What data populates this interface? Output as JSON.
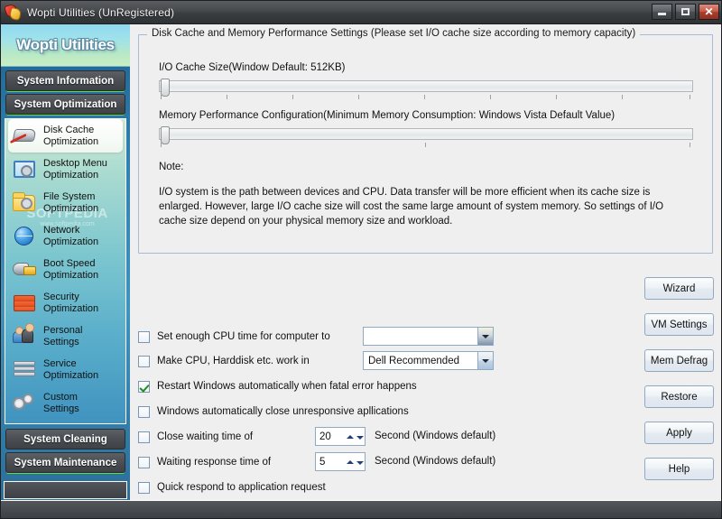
{
  "window": {
    "title": "Wopti Utilities (UnRegistered)",
    "icon": "app-shield-icon",
    "controls": {
      "minimize": "minimize-icon",
      "maximize": "maximize-icon",
      "close": "✕"
    }
  },
  "sidebar": {
    "brand": "Wopti Utilities",
    "top_buttons": [
      {
        "label": "System Information"
      },
      {
        "label": "System Optimization"
      }
    ],
    "watermark": {
      "line1": "SOFTPEDIA",
      "line2": "www.softpedia.com"
    },
    "items": [
      {
        "label": "Disk Cache\nOptimization",
        "icon": "disk-icon",
        "selected": true
      },
      {
        "label": "Desktop Menu\nOptimization",
        "icon": "desktop-menu-icon",
        "selected": false
      },
      {
        "label": "File System\nOptimization",
        "icon": "folder-icon",
        "selected": false
      },
      {
        "label": "Network\nOptimization",
        "icon": "globe-icon",
        "selected": false
      },
      {
        "label": "Boot Speed\nOptimization",
        "icon": "rocket-icon",
        "selected": false
      },
      {
        "label": "Security\nOptimization",
        "icon": "firewall-icon",
        "selected": false
      },
      {
        "label": "Personal\nSettings",
        "icon": "users-icon",
        "selected": false
      },
      {
        "label": "Service\nOptimization",
        "icon": "server-icon",
        "selected": false
      },
      {
        "label": "Custom\nSettings",
        "icon": "gears-icon",
        "selected": false
      }
    ],
    "bottom_buttons": [
      {
        "label": "System Cleaning"
      },
      {
        "label": "System Maintenance"
      }
    ]
  },
  "main": {
    "group": {
      "title": "Disk Cache and Memory Performance Settings (Please set I/O cache size according to memory capacity)",
      "slider1": {
        "label": "I/O Cache Size(Window Default: 512KB)",
        "value": 0,
        "tick_count": 9
      },
      "slider2": {
        "label": "Memory Performance Configuration(Minimum Memory Consumption: Windows Vista Default Value)",
        "value": 0,
        "tick_count": 3
      },
      "note_label": "Note:",
      "note_body": "I/O system is the path between devices and CPU. Data transfer will be more efficient when its cache size is enlarged. However, large I/O cache size will cost the same large amount of system memory. So settings of I/O cache size depend on your physical memory size and workload."
    },
    "options": [
      {
        "label": "Set enough CPU time for computer to",
        "checked": false,
        "control": "combo",
        "value": ""
      },
      {
        "label": "Make CPU, Harddisk etc. work in",
        "checked": false,
        "control": "combo",
        "value": "Dell Recommended"
      },
      {
        "label": "Restart Windows automatically when fatal error happens",
        "checked": true,
        "control": "none",
        "value": ""
      },
      {
        "label": "Windows automatically close unresponsive apllications",
        "checked": false,
        "control": "none",
        "value": ""
      },
      {
        "label": "Close waiting time of",
        "checked": false,
        "control": "spinner",
        "value": "20",
        "unit": "Second (Windows default)"
      },
      {
        "label": "Waiting response time of",
        "checked": false,
        "control": "spinner",
        "value": "5",
        "unit": "Second (Windows default)"
      },
      {
        "label": "Quick respond to application request",
        "checked": false,
        "control": "none",
        "value": ""
      }
    ],
    "buttons": [
      {
        "label": "Wizard"
      },
      {
        "label": "VM Settings"
      },
      {
        "label": "Mem Defrag"
      },
      {
        "label": "Restore"
      },
      {
        "label": "Apply"
      },
      {
        "label": "Help"
      }
    ]
  },
  "statusbar": {
    "text": ""
  },
  "colors": {
    "accent_blue": "#2e7fae",
    "titlebar": "#46494c",
    "panel_bg": "#efefef",
    "group_border": "#a5bcd4",
    "check_green": "#1d8f1d",
    "close_red": "#c55a48"
  }
}
